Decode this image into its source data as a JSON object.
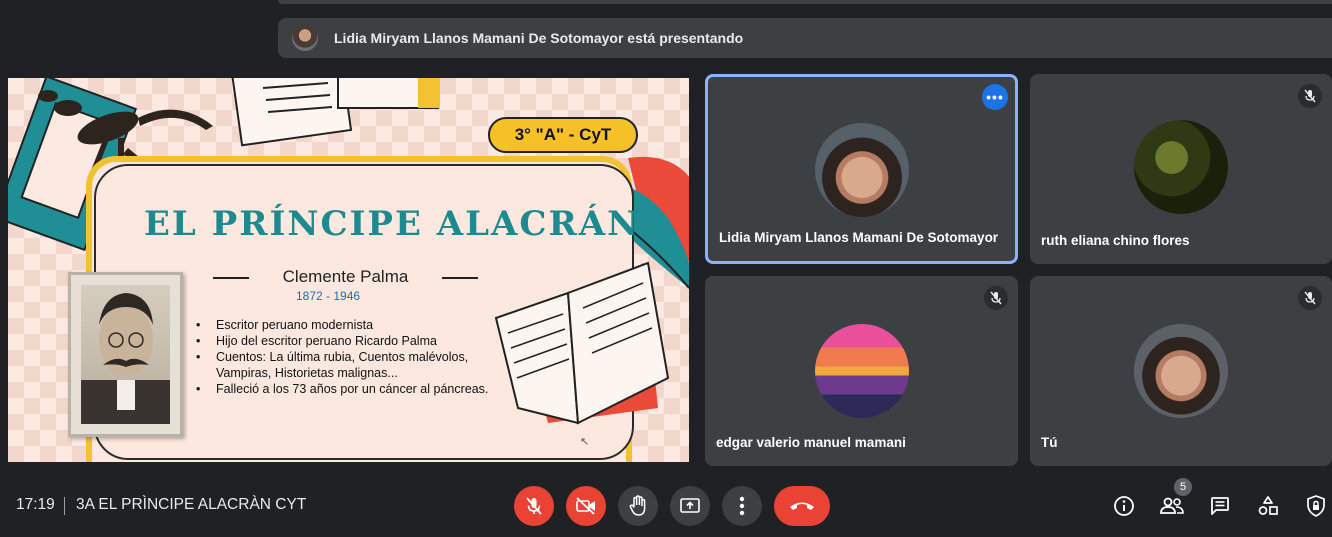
{
  "banner": {
    "presenting_text": "Lidia Miryam Llanos Mamani De Sotomayor está presentando"
  },
  "slide": {
    "tag": "3° \"A\" - CyT",
    "title": "EL PRÍNCIPE ALACRÁN",
    "author": "Clemente Palma",
    "years": "1872 - 1946",
    "bullets": [
      "Escritor peruano modernista",
      "Hijo del escritor peruano Ricardo Palma",
      "Cuentos: La última rubia, Cuentos malévolos, Vampiras, Historietas malignas...",
      "Falleció a los 73 años por un cáncer al páncreas."
    ]
  },
  "participants": [
    {
      "name": "Lidia Miryam Llanos Mamani De Sotomayor",
      "state": "active-speaker",
      "icon": "more-options-icon"
    },
    {
      "name": "ruth eliana chino flores",
      "icon": "mic-off-icon"
    },
    {
      "name": "edgar valerio manuel mamani",
      "icon": "mic-off-icon"
    },
    {
      "name": "Tú",
      "icon": "mic-off-icon"
    }
  ],
  "bottom_bar": {
    "time": "17:19",
    "meeting_title": "3A EL PRÌNCIPE ALACRÀN CYT",
    "participant_count": "5"
  },
  "colors": {
    "background": "#202124",
    "tile": "#3c4043",
    "danger": "#ea4335",
    "accent": "#1a73e8",
    "active_border": "#8ab4f8"
  }
}
